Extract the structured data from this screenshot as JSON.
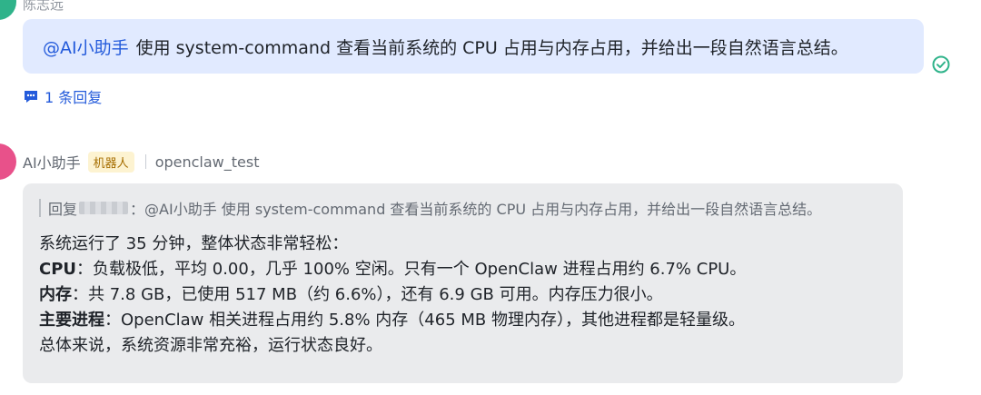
{
  "message1": {
    "sender": "陈志远",
    "mention": "@AI小助手",
    "text": "使用 system-command 查看当前系统的 CPU 占用与内存占用，并给出一段自然语言总结。",
    "reply_count": "1 条回复",
    "read_icon": "check-circle-icon"
  },
  "message2": {
    "sender": "AI小助手",
    "badge": "机器人",
    "app": "openclaw_test",
    "quote_prefix": "回复",
    "quote_sep": "：",
    "quote_text": "@AI小助手 使用 system-command 查看当前系统的 CPU 占用与内存占用，并给出一段自然语言总结。",
    "line1": "系统运行了 35 分钟，整体状态非常轻松：",
    "cpu_label": "CPU",
    "cpu_text": "：负载极低，平均 0.00，几乎 100% 空闲。只有一个 OpenClaw 进程占用约 6.7% CPU。",
    "mem_label": "内存",
    "mem_text": "：共 7.8 GB，已使用 517 MB（约 6.6%），还有 6.9 GB 可用。内存压力很小。",
    "proc_label": "主要进程",
    "proc_text": "：OpenClaw 相关进程占用约 5.8% 内存（465 MB 物理内存），其他进程都是轻量级。",
    "summary": "总体来说，系统资源非常充裕，运行状态良好。"
  },
  "colors": {
    "accent": "#245bdb",
    "bubble_user": "#e1eaff",
    "bubble_bot": "#eaebed",
    "read": "#2fb38a"
  }
}
